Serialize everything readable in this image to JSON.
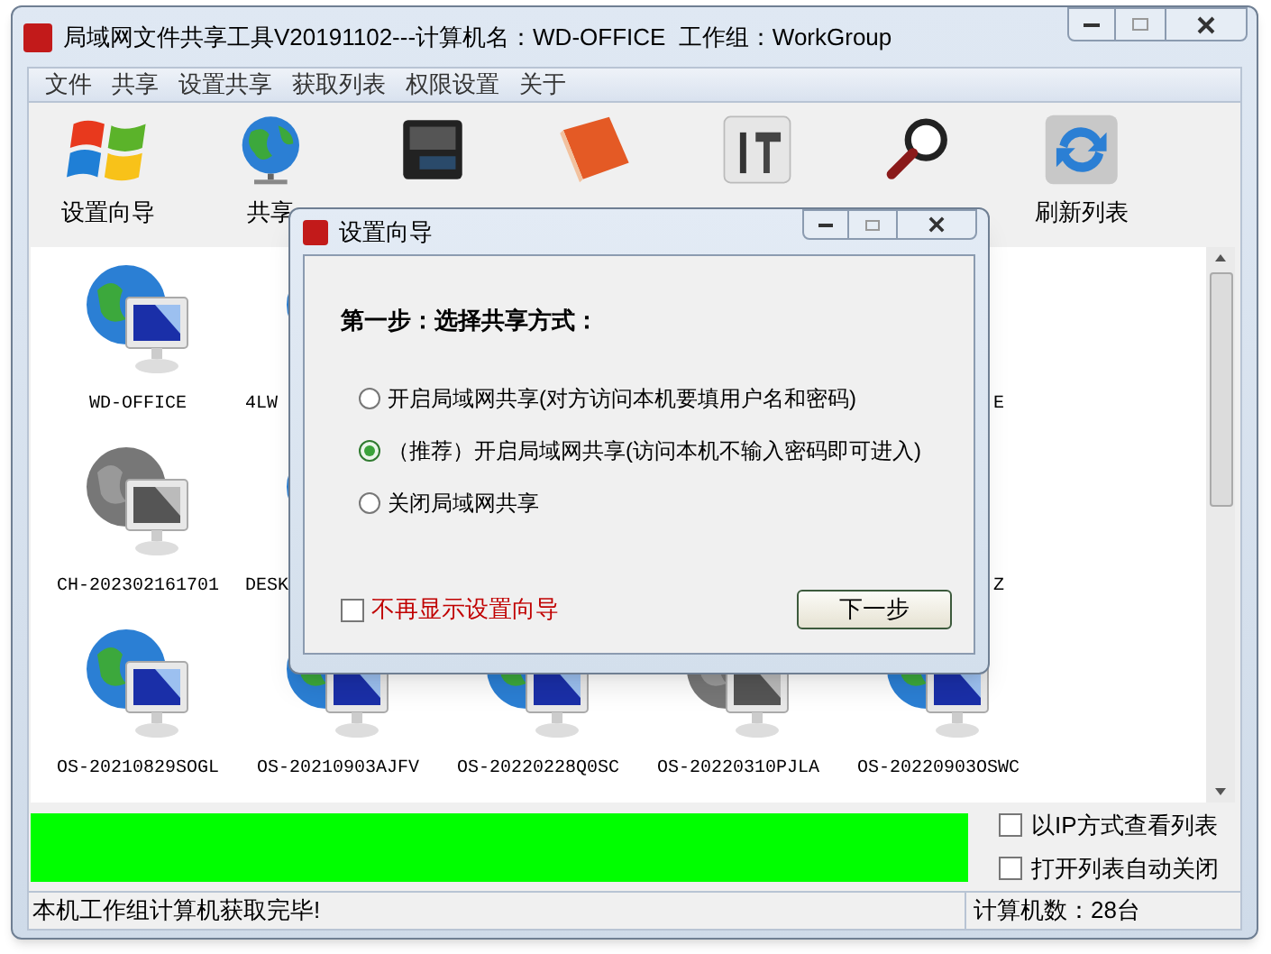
{
  "window": {
    "title": "局域网文件共享工具V20191102---计算机名：WD-OFFICE  工作组：WorkGroup"
  },
  "menu": [
    "文件",
    "共享",
    "设置共享",
    "获取列表",
    "权限设置",
    "关于"
  ],
  "toolbar": [
    {
      "kind": "windows",
      "label": "设置向导"
    },
    {
      "kind": "globe",
      "label": "共享"
    },
    {
      "kind": "printer"
    },
    {
      "kind": "folder"
    },
    {
      "kind": "tools"
    },
    {
      "kind": "search"
    },
    {
      "kind": "refresh",
      "label": "刷新列表"
    }
  ],
  "computers": [
    [
      {
        "name": "WD-OFFICE",
        "online": true
      },
      {
        "name": "4LW",
        "online": true
      },
      {
        "name": "E"
      }
    ],
    [
      {
        "name": "CH-202302161701",
        "online": false
      },
      {
        "name": "DESK",
        "online": true
      },
      {
        "name": "Z"
      }
    ],
    [
      {
        "name": "OS-20210829SOGL",
        "online": true
      },
      {
        "name": "OS-20210903AJFV",
        "online": true
      },
      {
        "name": "OS-20220228Q0SC",
        "online": true
      },
      {
        "name": "OS-20220310PJLA",
        "online": false
      },
      {
        "name": "OS-20220903OSWC",
        "online": true
      }
    ]
  ],
  "progress": {
    "level": 1
  },
  "options": [
    {
      "label": "以IP方式查看列表",
      "checked": false
    },
    {
      "label": "打开列表自动关闭",
      "checked": false
    }
  ],
  "status_bar": {
    "message": "本机工作组计算机获取完毕!",
    "count": "计算机数：28台"
  },
  "dialog": {
    "title": "设置向导",
    "heading": "第一步：选择共享方式：",
    "options": [
      {
        "label": "开启局域网共享(对方访问本机要填用户名和密码)",
        "selected": false
      },
      {
        "label": "（推荐）开启局域网共享(访问本机不输入密码即可进入)",
        "selected": true
      },
      {
        "label": "关闭局域网共享",
        "selected": false
      }
    ],
    "dont_show": {
      "label": "不再显示设置向导",
      "checked": false
    },
    "next_button": "下一步"
  }
}
